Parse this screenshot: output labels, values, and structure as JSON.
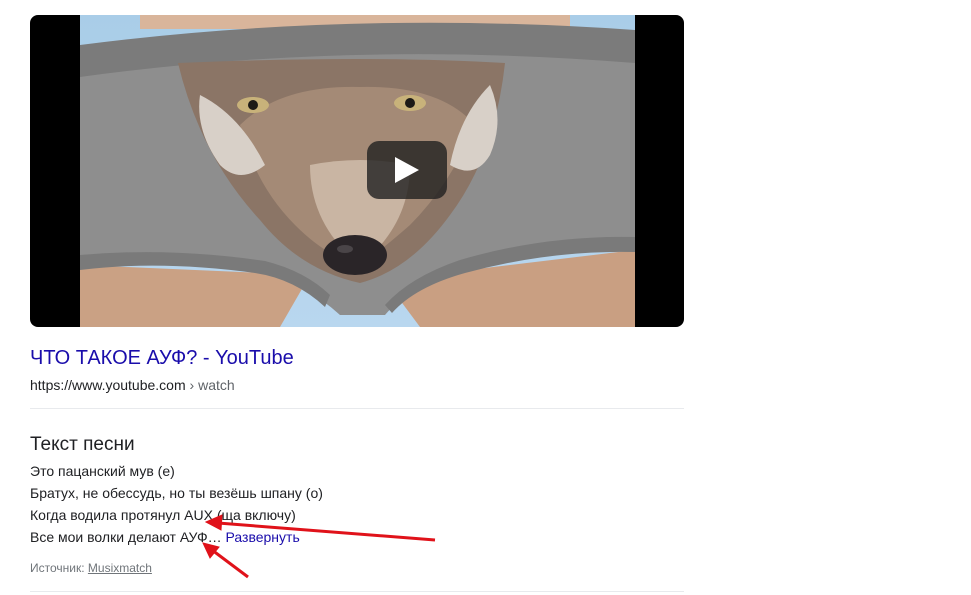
{
  "video": {
    "thumbnail_description_icon": "video-thumbnail",
    "play_icon": "play-icon"
  },
  "result": {
    "title": "ЧТО ТАКОЕ АУФ? - YouTube",
    "url_domain": "https://www.youtube.com",
    "url_path": " › watch"
  },
  "lyrics": {
    "heading": "Текст песни",
    "lines": [
      "Это пацанский мув (е)",
      "Братух, не обессудь, но ты везёшь шпану (о)",
      "Когда водила протянул AUX (ща включу)",
      "Все мои волки делают АУФ… "
    ],
    "expand_label": "Развернуть",
    "source_label": "Источник: ",
    "source_name": "Musixmatch"
  },
  "colors": {
    "link": "#1a0dab",
    "text": "#202124",
    "muted": "#70757a",
    "annotation_arrow": "#e0121a"
  }
}
